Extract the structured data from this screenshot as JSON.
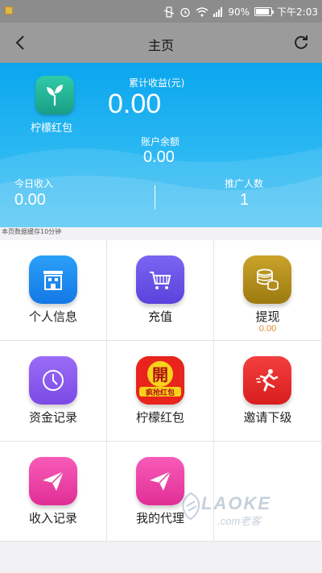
{
  "status_bar": {
    "battery": "90%",
    "time": "下午2:03"
  },
  "title_bar": {
    "title": "主页"
  },
  "header": {
    "logo_label": "柠檬红包",
    "cumulative_label": "累计收益(元)",
    "cumulative_value": "0.00",
    "balance_label": "账户余额",
    "balance_value": "0.00",
    "today_label": "今日收入",
    "today_value": "0.00",
    "promo_label": "推广人数",
    "promo_value": "1"
  },
  "cache_note": "本页数据缓存10分钟",
  "grid": {
    "items": [
      {
        "label": "个人信息",
        "icon": "building-icon",
        "color": "#1f8ef2"
      },
      {
        "label": "充值",
        "icon": "cart-icon",
        "color": "#6a55e8"
      },
      {
        "label": "提现",
        "sub": "0.00",
        "icon": "coins-icon",
        "color": "#b8921a"
      },
      {
        "label": "资金记录",
        "icon": "clock-icon",
        "color": "#8e5af0"
      },
      {
        "label": "柠檬红包",
        "icon": "red-envelope-icon",
        "badge_top": "開",
        "badge_bottom": "疯抢红包",
        "color": "#e8241c"
      },
      {
        "label": "邀请下级",
        "icon": "runner-icon",
        "color": "#ee2b2b"
      },
      {
        "label": "收入记录",
        "icon": "paper-plane-icon",
        "color": "#f041a8"
      },
      {
        "label": "我的代理",
        "icon": "paper-plane-icon",
        "color": "#f041a8"
      }
    ]
  },
  "watermark": {
    "line1": "LAOKE",
    "line2": ".com老客"
  }
}
